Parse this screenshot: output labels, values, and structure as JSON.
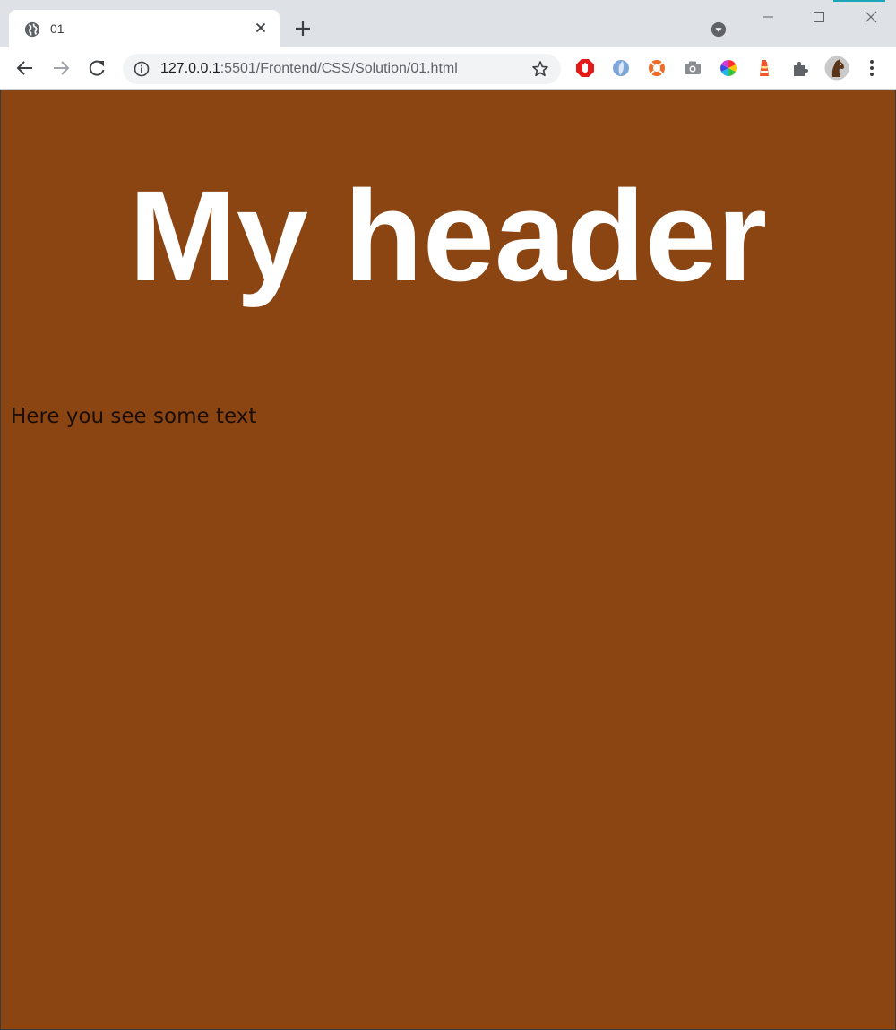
{
  "tab": {
    "title": "01"
  },
  "omnibox": {
    "url_host": "127.0.0.1",
    "url_rest": ":5501/Frontend/CSS/Solution/01.html"
  },
  "extensions": [
    "adblock-icon",
    "dropbox-like-icon",
    "lifebuoy-icon",
    "camera-icon",
    "color-wheel-icon",
    "lighthouse-icon",
    "extensions-puzzle-icon",
    "profile-avatar-icon"
  ],
  "page": {
    "heading": "My header",
    "paragraph": "Here you see some text",
    "background_color": "#8b4513",
    "heading_color": "#ffffff"
  }
}
